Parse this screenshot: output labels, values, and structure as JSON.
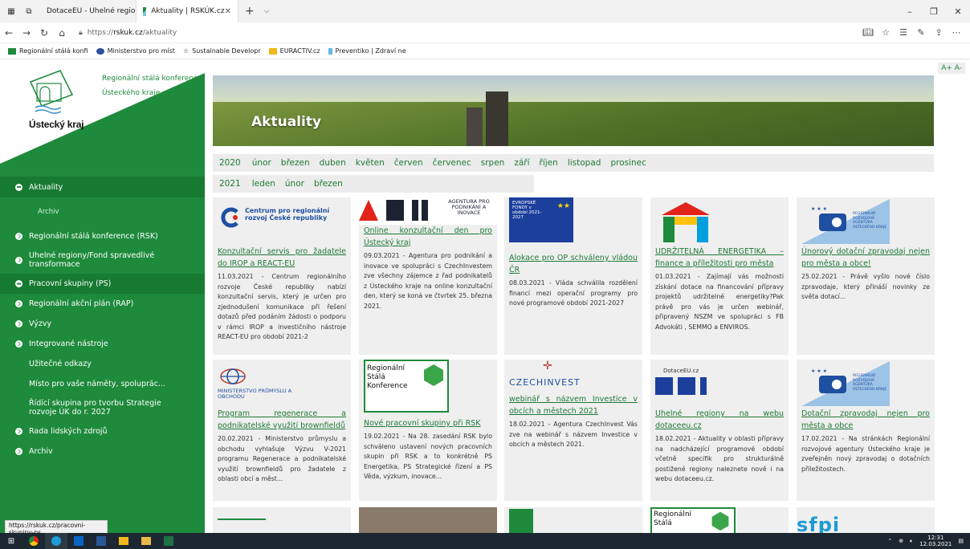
{
  "browser": {
    "tabs": [
      {
        "label": "DotaceEU - Uhelné regiony"
      },
      {
        "label": "Aktuality | RSKÚK.cz"
      }
    ],
    "address": {
      "prefix": "https://",
      "host": "rskuk.cz",
      "path": "/aktuality"
    },
    "favorites": [
      "Regionální stálá konfi",
      "Ministerstvo pro míst",
      "Sustainable Developr",
      "EURACTIV.cz",
      "Preventiko | Zdraví ne"
    ],
    "status_url": "https://rskuk.cz/pracovni-skupiny-ps"
  },
  "site": {
    "logo_name": "Ústecký kraj",
    "logo_sub_1": "Regionální stálá konference",
    "logo_sub_2": "Ústeckého kraje",
    "font_controls": "A+ A-",
    "hero_title": "Aktuality"
  },
  "menu": [
    {
      "label": "Aktuality",
      "kind": "active"
    },
    {
      "label": "Archiv",
      "kind": "sub"
    },
    {
      "label": "Regionální stálá konference (RSK)",
      "kind": "main"
    },
    {
      "label": "Uhelné regiony/Fond spravedlivé transformace",
      "kind": "main"
    },
    {
      "label": "Pracovní skupiny (PS)",
      "kind": "active2"
    },
    {
      "label": "Regionální akční plán (RAP)",
      "kind": "main"
    },
    {
      "label": "Výzvy",
      "kind": "main"
    },
    {
      "label": "Integrované nástroje",
      "kind": "main"
    },
    {
      "label": "Užitečné odkazy",
      "kind": "plain"
    },
    {
      "label": "Místo pro vaše náměty, spoluprác...",
      "kind": "plain"
    },
    {
      "label": "Řídící skupina pro tvorbu Strategie rozvoje ÚK do r. 2027",
      "kind": "plain"
    },
    {
      "label": "Rada lidských zdrojů",
      "kind": "main"
    },
    {
      "label": "Archiv",
      "kind": "main"
    }
  ],
  "months_2020": {
    "year": "2020",
    "items": [
      "únor",
      "březen",
      "duben",
      "květen",
      "červen",
      "červenec",
      "srpen",
      "září",
      "říjen",
      "listopad",
      "prosinec"
    ]
  },
  "months_2021": {
    "year": "2021",
    "items": [
      "leden",
      "únor",
      "březen"
    ]
  },
  "cards_row1": [
    {
      "logo": "Centrum pro regionální rozvoj České republiky",
      "title": "Konzultační servis pro žadatele do IROP a REACT-EU",
      "text": "11.03.2021 - Centrum regionálního rozvoje České republiky nabízí konzultační servis, který je určen pro zjednodušení komunikace při řešení dotazů před podáním žádosti o podporu v rámci IROP a investičního nástroje REACT-EU pro období 2021-2"
    },
    {
      "logo": "AGENTURA PRO PODNIKÁNÍ A INOVACE",
      "title": "Online konzultační den pro Ústecký kraj",
      "text": "09.03.2021 - Agentura pro podnikání a inovace ve spolupráci s CzechInvestem zve všechny zájemce z řad podnikatelů z Ústeckého kraje na online konzultační den, který se koná ve čtvrtek 25. března 2021."
    },
    {
      "logo": "EVROPSKÉ FONDY v období 2021-2027",
      "title": "Alokace pro OP schváleny vládou ČR",
      "text": "08.03.2021 - Vláda schválila rozdělení financí mezi operační programy pro nové programové období 2021-2027"
    },
    {
      "logo": "",
      "title": "UDRŽITELNÁ ENERGETIKA – finance a příležitosti pro města",
      "text": "01.03.2021 - Zajímají vás možnosti získání dotace na financování přípravy projektů udržitelné energetiky?Pak právě pro vás je určen webinář, připravený NSZM ve spolupráci s FB Advokáti , SEMMO a ENVIROS."
    },
    {
      "logo": "REGIONÁLNÍ ROZVOJOVÁ AGENTURA ÚSTECKÉHO KRAJE",
      "title": "Únorový dotační zpravodaj nejen pro města a obce!",
      "text": "25.02.2021 - Právě vyšlo nové číslo zpravodaje, který přináší novinky ze světa dotací..."
    }
  ],
  "cards_row2": [
    {
      "logo": "MINISTERSTVO PRŮMYSLU A OBCHODU",
      "title": "Program regenerace a podnikatelské využití brownfieldů",
      "text": "20.02.2021 - Ministerstvo průmyslu a obchodu vyhlašuje Výzvu V-2021 programu Regenerace a podnikatelské využití brownfieldů pro žadatele z oblasti obcí a měst..."
    },
    {
      "logo": "Regionální Stálá Konference",
      "title": "Nové pracovní skupiny při RSK",
      "text": "19.02.2021 - Na 28. zasedání RSK bylo schváleno ustavení nových pracovních skupin při RSK a to konkrétně PS Energetika, PS Strategické řízení a PS Věda, výzkum, inovace..."
    },
    {
      "logo": "CZECHINVEST",
      "title": "webinář s názvem Investice v obcích a městech 2021",
      "text": "18.02.2021 - Agentura CzechInvest Vás zve na webinář s názvem Investice v obcích a městech 2021."
    },
    {
      "logo": "DotaceEU.cz",
      "title": "Uhelné regiony na webu dotaceeu.cz",
      "text": "18.02.2021 - Aktuality v oblasti přípravy na nadcházející programové období včetně specifik pro strukturálně postižené regiony naleznete nově i na webu dotaceeu.cz."
    },
    {
      "logo": "REGIONÁLNÍ ROZVOJOVÁ AGENTURA ÚSTECKÉHO KRAJE",
      "title": "Dotační zpravodaj nejen pro města a obce",
      "text": "17.02.2021 - Na stránkách Regionální rozvojové agentury Ústeckého kraje je zveřejněn nový zpravodaj o dotačních příležitostech."
    }
  ],
  "row3_logos": [
    "Regionální Stálá",
    "sfpi"
  ],
  "taskbar": {
    "time": "12:31",
    "date": "12.03.2021"
  }
}
